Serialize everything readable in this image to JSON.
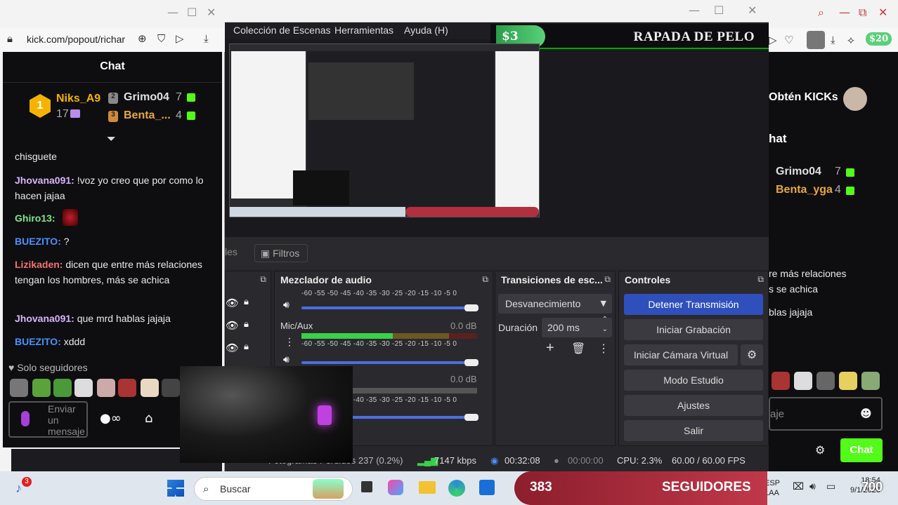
{
  "left_browser": {
    "url": "kick.com/popout/richar",
    "chat_title": "Chat",
    "leaderboard": [
      {
        "rank": "1",
        "name": "Niks_A9",
        "count": "17"
      },
      {
        "rank": "2",
        "name": "Grimo04",
        "count": "7"
      },
      {
        "rank": "3",
        "name": "Benta_...",
        "count": "4"
      }
    ],
    "messages": [
      {
        "user": "",
        "text": "chisguete",
        "color": "#eaeaea"
      },
      {
        "user": "Jhovana091",
        "text": " !voz yo creo que por como lo hacen jajaa",
        "color": "#d8b4fe"
      },
      {
        "user": "Ghiro13",
        "text": "",
        "color": "#7ee787"
      },
      {
        "user": "BUEZITO",
        "text": " ?",
        "color": "#4a90ff"
      },
      {
        "user": "Lizikaden",
        "text": " dicen que entre más relaciones tengan los hombres, más se achica",
        "color": "#f87171"
      },
      {
        "user": "Jhovana091",
        "text": " que mrd hablas jajaja",
        "color": "#d8b4fe"
      },
      {
        "user": "BUEZITO",
        "text": " xddd",
        "color": "#4a90ff"
      }
    ],
    "followers_only": "Solo seguidores",
    "input_placeholder": "Enviar un mensaje"
  },
  "obs": {
    "menu": [
      "Colección de Escenas",
      "Herramientas",
      "Ayuda (H)"
    ],
    "banner_amount": "$3",
    "banner_text": "RAPADA DE PELO",
    "tab_partial": "les",
    "filters_label": "Filtros",
    "mixer": {
      "title": "Mezclador de audio",
      "scale": "-60 -55 -50 -45 -40 -35 -30 -25 -20 -15 -10 -5 0",
      "channels": [
        {
          "name": "",
          "db": ""
        },
        {
          "name": "Mic/Aux",
          "db": "0.0 dB"
        },
        {
          "name": "",
          "db": "0.0 dB"
        }
      ]
    },
    "transitions": {
      "title": "Transiciones de esc...",
      "selected": "Desvanecimiento",
      "duration_label": "Duración",
      "duration_value": "200 ms"
    },
    "controls": {
      "title": "Controles",
      "buttons": [
        "Detener Transmisión",
        "Iniciar Grabación",
        "Iniciar Cámara Virtual",
        "Modo Estudio",
        "Ajustes",
        "Salir"
      ]
    },
    "status": {
      "frames": "Fotogramas Perdidos 237 (0.2%)",
      "bitrate": "7147 kbps",
      "live_time": "00:32:08",
      "rec_time": "00:00:00",
      "cpu": "CPU: 2.3%",
      "fps": "60.00 / 60.00 FPS"
    }
  },
  "right_browser": {
    "get_kicks": "Obtén KICKs",
    "chat": "hat",
    "leaders": [
      {
        "name": "Grimo04",
        "count": "7"
      },
      {
        "name": "Benta_yga",
        "count": "4"
      }
    ],
    "lines": [
      "re más relaciones",
      "s se achica",
      "blas jajaja"
    ],
    "input_partial": "aje",
    "chat_button": "Chat",
    "badge": "$20"
  },
  "taskbar": {
    "notif": "3",
    "search": "Buscar",
    "followers_count": "383",
    "followers_label": "SEGUIDORES",
    "lang": "ESP",
    "lang2": "LAA",
    "time": "18:54",
    "date": "9/1/2026",
    "right_count": "700"
  },
  "colors": {
    "kick_green": "#53fc18",
    "obs_blue": "#2f4fbd"
  }
}
